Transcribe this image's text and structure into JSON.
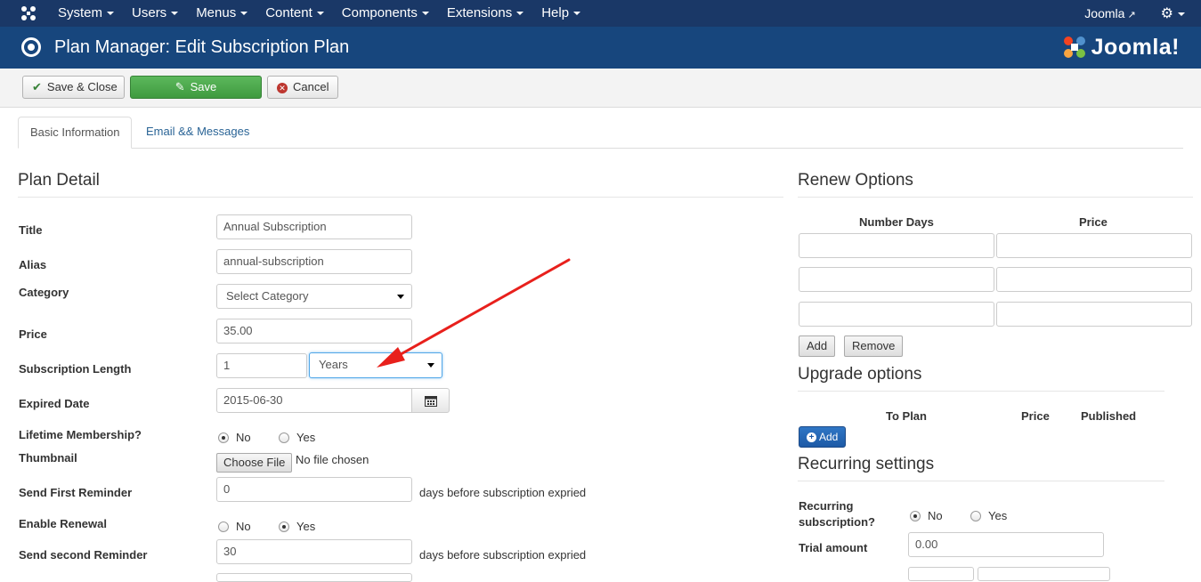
{
  "topnav": {
    "menu": [
      "System",
      "Users",
      "Menus",
      "Content",
      "Components",
      "Extensions",
      "Help"
    ],
    "site_link": "Joomla"
  },
  "title": "Plan Manager: Edit Subscription Plan",
  "brand": "Joomla!",
  "toolbar": {
    "save_close": "Save & Close",
    "save": "Save",
    "cancel": "Cancel"
  },
  "tabs": {
    "basic": "Basic Information",
    "email": "Email && Messages"
  },
  "plan_detail": {
    "heading": "Plan Detail",
    "title_label": "Title",
    "title_value": "Annual Subscription",
    "alias_label": "Alias",
    "alias_value": "annual-subscription",
    "category_label": "Category",
    "category_value": "Select Category",
    "price_label": "Price",
    "price_value": "35.00",
    "length_label": "Subscription Length",
    "length_value": "1",
    "length_unit": "Years",
    "expired_label": "Expired Date",
    "expired_value": "2015-06-30",
    "lifetime_label": "Lifetime Membership?",
    "lifetime_no": "No",
    "lifetime_yes": "Yes",
    "thumbnail_label": "Thumbnail",
    "choose_file": "Choose File",
    "no_file": "No file chosen",
    "first_reminder_label": "Send First Reminder",
    "first_reminder_value": "0",
    "days_suffix": "days before subscription expried",
    "renewal_label": "Enable Renewal",
    "renewal_no": "No",
    "renewal_yes": "Yes",
    "second_reminder_label": "Send second Reminder",
    "second_reminder_value": "30"
  },
  "renew": {
    "heading": "Renew Options",
    "col_days": "Number Days",
    "col_price": "Price",
    "add": "Add",
    "remove": "Remove"
  },
  "upgrade": {
    "heading": "Upgrade options",
    "col_to_plan": "To Plan",
    "col_price": "Price",
    "col_published": "Published",
    "add": "Add"
  },
  "recurring": {
    "heading": "Recurring settings",
    "recurring_label_1": "Recurring",
    "recurring_label_2": "subscription?",
    "no": "No",
    "yes": "Yes",
    "trial_label": "Trial amount",
    "trial_value": "0.00"
  },
  "colors": {
    "topnav_bg": "#1a3867",
    "titlebar_bg": "#17467d",
    "save_green": "#5cb85c",
    "annotation_arrow": "#e8201c"
  }
}
